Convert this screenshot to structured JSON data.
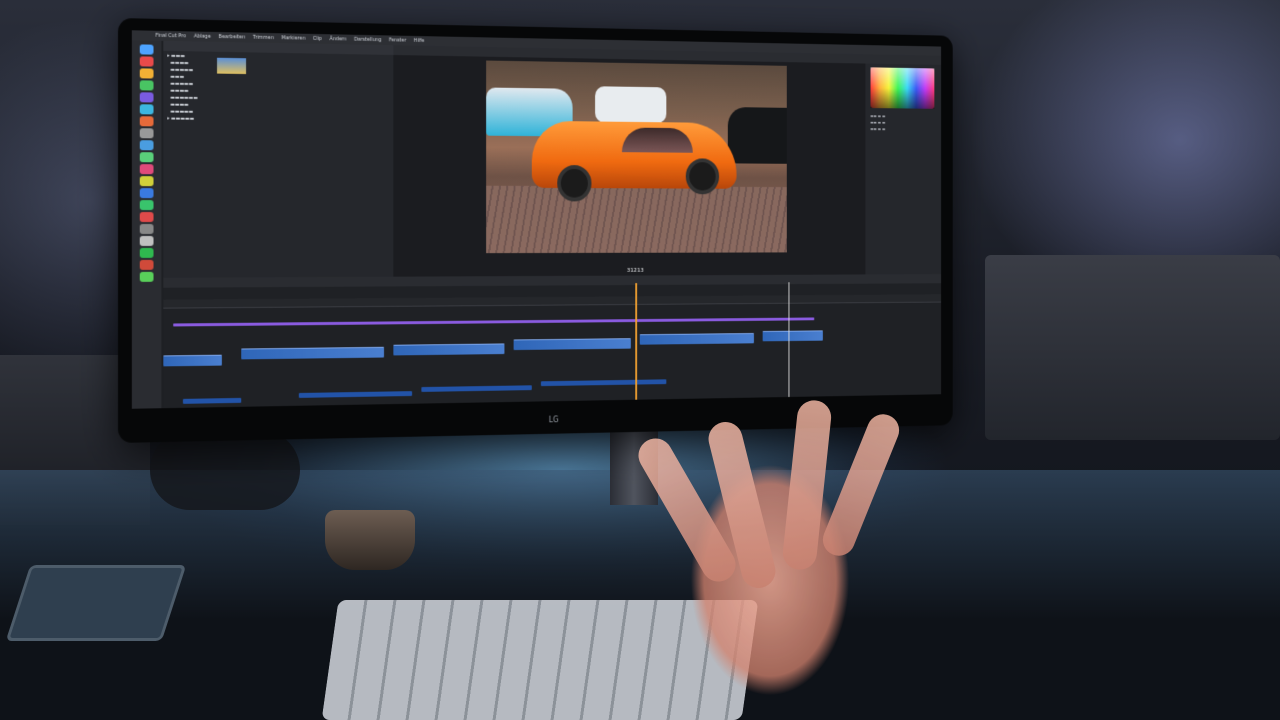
{
  "scene": {
    "monitor_brand": "LG"
  },
  "app": {
    "menu_items": [
      "Final Cut Pro",
      "Ablage",
      "Bearbeiten",
      "Trimmen",
      "Markieren",
      "Clip",
      "Ändern",
      "Darstellung",
      "Fenster",
      "Hilfe"
    ],
    "viewer_timecode": "31213",
    "accent_colors": {
      "video_clip": "#2f66b8",
      "audio_clip": "#2253a8",
      "title_track": "#8a5be0",
      "playhead": "#f0a030"
    },
    "icons": [
      "apple-icon",
      "dock-app-icons",
      "color-wheel-icon",
      "playhead-icon"
    ]
  }
}
